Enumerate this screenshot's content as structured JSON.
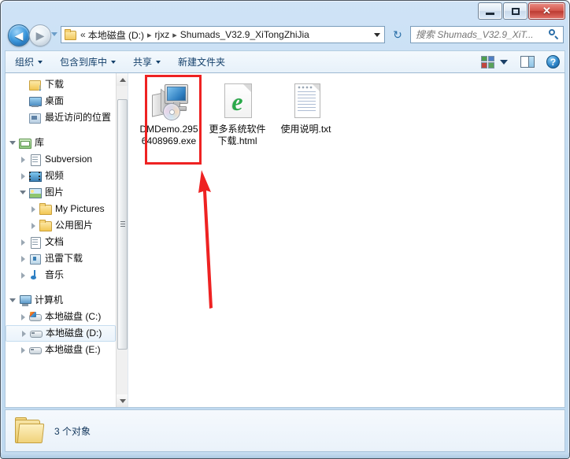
{
  "window": {
    "controls": {
      "minimize": "—",
      "maximize": "▫",
      "close": "✕"
    }
  },
  "nav": {
    "back_label": "◀",
    "forward_label": "▶",
    "back_name": "back-button",
    "forward_name": "forward-button",
    "recent_dropdown": "▾",
    "refresh_label": "↻"
  },
  "address": {
    "separator_double": "«",
    "crumbs": [
      {
        "label": "本地磁盘 (D:)"
      },
      {
        "label": "rjxz"
      },
      {
        "label": "Shumads_V32.9_XiTongZhiJia"
      }
    ],
    "crumb_separator": "▸",
    "dropdown": "▾"
  },
  "search": {
    "placeholder": "搜索 Shumads_V32.9_XiT...",
    "value": ""
  },
  "toolbar": {
    "items": [
      {
        "label": "组织",
        "has_caret": true
      },
      {
        "label": "包含到库中",
        "has_caret": true
      },
      {
        "label": "共享",
        "has_caret": true
      },
      {
        "label": "新建文件夹",
        "has_caret": false
      }
    ],
    "help_label": "?"
  },
  "sidebar": {
    "items": [
      {
        "label": "下载",
        "icon": "download-icon",
        "indent": 1,
        "twisty": "none",
        "selected": false
      },
      {
        "label": "桌面",
        "icon": "desktop-icon",
        "indent": 1,
        "twisty": "none",
        "selected": false
      },
      {
        "label": "最近访问的位置",
        "icon": "recent-places-icon",
        "indent": 1,
        "twisty": "none",
        "selected": false
      },
      {
        "label": "库",
        "icon": "library-icon",
        "indent": 0,
        "twisty": "open",
        "selected": false
      },
      {
        "label": "Subversion",
        "icon": "document-icon",
        "indent": 1,
        "twisty": "closed",
        "selected": false
      },
      {
        "label": "视频",
        "icon": "video-icon",
        "indent": 1,
        "twisty": "closed",
        "selected": false
      },
      {
        "label": "图片",
        "icon": "picture-icon",
        "indent": 1,
        "twisty": "open",
        "selected": false
      },
      {
        "label": "My Pictures",
        "icon": "folder-icon",
        "indent": 2,
        "twisty": "closed",
        "selected": false
      },
      {
        "label": "公用图片",
        "icon": "folder-icon",
        "indent": 2,
        "twisty": "closed",
        "selected": false
      },
      {
        "label": "文档",
        "icon": "document-icon",
        "indent": 1,
        "twisty": "closed",
        "selected": false
      },
      {
        "label": "迅雷下载",
        "icon": "thunder-download-icon",
        "indent": 1,
        "twisty": "closed",
        "selected": false
      },
      {
        "label": "音乐",
        "icon": "music-icon",
        "indent": 1,
        "twisty": "closed",
        "selected": false
      },
      {
        "label": "计算机",
        "icon": "computer-icon",
        "indent": 0,
        "twisty": "open",
        "selected": false
      },
      {
        "label": "本地磁盘 (C:)",
        "icon": "drive-windows-icon",
        "indent": 1,
        "twisty": "closed",
        "selected": false
      },
      {
        "label": "本地磁盘 (D:)",
        "icon": "drive-icon",
        "indent": 1,
        "twisty": "closed",
        "selected": true
      },
      {
        "label": "本地磁盘 (E:)",
        "icon": "drive-icon",
        "indent": 1,
        "twisty": "closed",
        "selected": false
      }
    ]
  },
  "files": [
    {
      "name": "DMDemo.2956408969.exe",
      "icon": "exe-application-icon",
      "highlighted": true
    },
    {
      "name": "更多系统软件下载.html",
      "icon": "html-document-icon",
      "highlighted": false
    },
    {
      "name": "使用说明.txt",
      "icon": "text-document-icon",
      "highlighted": false
    }
  ],
  "status": {
    "text": "3 个对象"
  },
  "annotation": {
    "color": "#ee2222",
    "box_target": "DMDemo.2956408969.exe",
    "arrow": "points-up-left-to-exe-file"
  },
  "colors": {
    "titlebar": "#cfe3f6",
    "accent": "#14406b",
    "annotation_red": "#ee2222",
    "close_button": "#c8443a"
  }
}
